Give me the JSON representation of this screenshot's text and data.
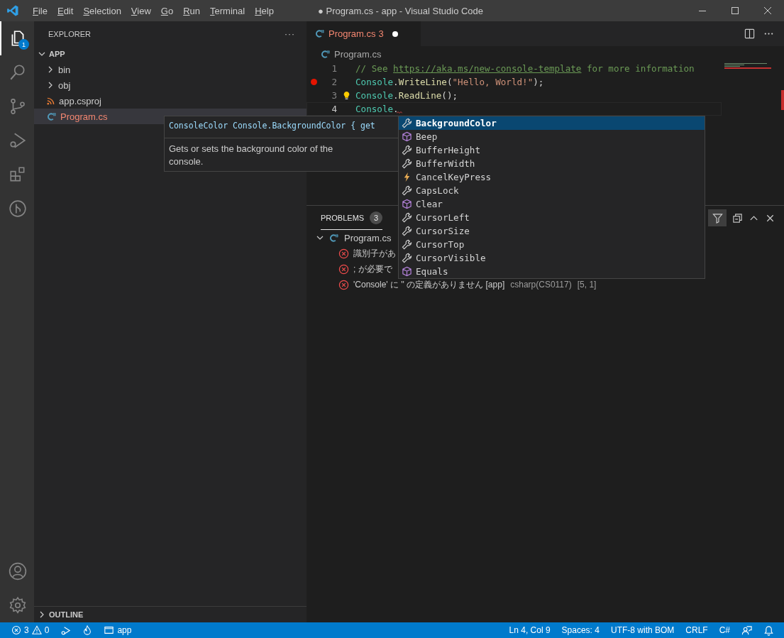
{
  "window": {
    "title": "● Program.cs - app - Visual Studio Code"
  },
  "menu": [
    "File",
    "Edit",
    "Selection",
    "View",
    "Go",
    "Run",
    "Terminal",
    "Help"
  ],
  "activity_bar": [
    {
      "kind": "files",
      "selected": true,
      "badge": "1"
    },
    {
      "kind": "search",
      "selected": false
    },
    {
      "kind": "source-control",
      "selected": false
    },
    {
      "kind": "run",
      "selected": false
    },
    {
      "kind": "extensions",
      "selected": false
    },
    {
      "kind": "remote",
      "selected": false
    }
  ],
  "sidebar": {
    "title": "EXPLORER",
    "more": "···",
    "section": {
      "title": "APP",
      "expanded": true,
      "items": [
        {
          "label": "bin",
          "kind": "folder",
          "expanded": false,
          "has_errors": false,
          "selected": false
        },
        {
          "label": "obj",
          "kind": "folder",
          "expanded": false,
          "has_errors": false,
          "selected": false
        },
        {
          "label": "app.csproj",
          "kind": "project",
          "has_errors": false,
          "selected": false
        },
        {
          "label": "Program.cs",
          "kind": "csharp",
          "has_errors": true,
          "selected": true
        }
      ]
    },
    "outline": {
      "title": "OUTLINE",
      "expanded": false
    }
  },
  "editor": {
    "tabs": [
      {
        "label": "Program.cs",
        "count": "3",
        "dirty": true,
        "has_errors": true,
        "selected": true
      }
    ],
    "breadcrumb": "Program.cs",
    "lines": [
      {
        "number": "1",
        "current": false,
        "breakpoint": false,
        "lightbulb": false,
        "tokens": [
          {
            "text": "// See ",
            "kind": "comment"
          },
          {
            "text": "https://aka.ms/new-console-template",
            "kind": "link"
          },
          {
            "text": " for more information",
            "kind": "comment"
          }
        ]
      },
      {
        "number": "2",
        "current": false,
        "breakpoint": true,
        "lightbulb": false,
        "tokens": [
          {
            "text": "Console",
            "kind": "class"
          },
          {
            "text": ".",
            "kind": "punct"
          },
          {
            "text": "WriteLine",
            "kind": "method"
          },
          {
            "text": "(",
            "kind": "punct"
          },
          {
            "text": "\"Hello, World!\"",
            "kind": "string"
          },
          {
            "text": ");",
            "kind": "punct"
          }
        ]
      },
      {
        "number": "3",
        "current": false,
        "breakpoint": false,
        "lightbulb": true,
        "tokens": [
          {
            "text": "Console",
            "kind": "class"
          },
          {
            "text": ".",
            "kind": "punct"
          },
          {
            "text": "ReadLine",
            "kind": "method"
          },
          {
            "text": "();",
            "kind": "punct"
          }
        ]
      },
      {
        "number": "4",
        "current": true,
        "breakpoint": false,
        "lightbulb": false,
        "tokens": [
          {
            "text": "Console",
            "kind": "class"
          },
          {
            "text": ".",
            "kind": "punct"
          }
        ]
      }
    ]
  },
  "hover": {
    "signature": "ConsoleColor Console.BackgroundColor { get",
    "description": "Gets or sets the background color of the console."
  },
  "suggestions": [
    {
      "label": "BackgroundColor",
      "kind": "property",
      "selected": true
    },
    {
      "label": "Beep",
      "kind": "method",
      "selected": false
    },
    {
      "label": "BufferHeight",
      "kind": "property",
      "selected": false
    },
    {
      "label": "BufferWidth",
      "kind": "property",
      "selected": false
    },
    {
      "label": "CancelKeyPress",
      "kind": "event",
      "selected": false
    },
    {
      "label": "CapsLock",
      "kind": "property",
      "selected": false
    },
    {
      "label": "Clear",
      "kind": "method",
      "selected": false
    },
    {
      "label": "CursorLeft",
      "kind": "property",
      "selected": false
    },
    {
      "label": "CursorSize",
      "kind": "property",
      "selected": false
    },
    {
      "label": "CursorTop",
      "kind": "property",
      "selected": false
    },
    {
      "label": "CursorVisible",
      "kind": "property",
      "selected": false
    },
    {
      "label": "Equals",
      "kind": "method",
      "selected": false
    }
  ],
  "panel": {
    "tabs": [
      {
        "label": "PROBLEMS",
        "badge": "3",
        "selected": true
      }
    ],
    "file": {
      "label": "Program.cs",
      "expanded": true,
      "problems": [
        {
          "message": "識別子があ"
        },
        {
          "message": "; が必要で"
        },
        {
          "message": "'Console' に '' の定義がありません [app]",
          "source": "csharp(CS0117)",
          "position": "[5, 1]"
        }
      ]
    }
  },
  "status_bar": {
    "errors": "3",
    "warnings": "0",
    "folder": "app",
    "right": [
      "Ln 4, Col 9",
      "Spaces: 4",
      "UTF-8 with BOM",
      "CRLF",
      "C#"
    ]
  }
}
